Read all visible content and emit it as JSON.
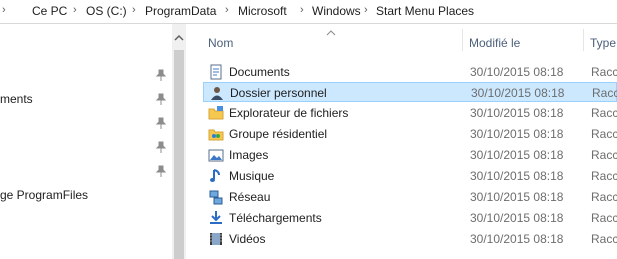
{
  "breadcrumb": {
    "parts": [
      "Ce PC",
      "OS (C:)",
      "ProgramData",
      "Microsoft",
      "Windows",
      "Start Menu Places"
    ]
  },
  "nav": {
    "items": [
      "ments",
      "ge ProgramFiles"
    ]
  },
  "columns": {
    "name": "Nom",
    "modified": "Modifié le",
    "type": "Type"
  },
  "files": [
    {
      "name": "Documents",
      "date": "30/10/2015 08:18",
      "type": "Racco",
      "icon": "documents-icon"
    },
    {
      "name": "Dossier personnel",
      "date": "30/10/2015 08:18",
      "type": "Racco",
      "icon": "user-folder-icon",
      "selected": true
    },
    {
      "name": "Explorateur de fichiers",
      "date": "30/10/2015 08:18",
      "type": "Racco",
      "icon": "folder-icon"
    },
    {
      "name": "Groupe résidentiel",
      "date": "30/10/2015 08:18",
      "type": "Racco",
      "icon": "homegroup-icon"
    },
    {
      "name": "Images",
      "date": "30/10/2015 08:18",
      "type": "Racco",
      "icon": "images-icon"
    },
    {
      "name": "Musique",
      "date": "30/10/2015 08:18",
      "type": "Racco",
      "icon": "music-icon"
    },
    {
      "name": "Réseau",
      "date": "30/10/2015 08:18",
      "type": "Racco",
      "icon": "network-icon"
    },
    {
      "name": "Téléchargements",
      "date": "30/10/2015 08:18",
      "type": "Racco",
      "icon": "downloads-icon"
    },
    {
      "name": "Vidéos",
      "date": "30/10/2015 08:18",
      "type": "Racco",
      "icon": "videos-icon"
    }
  ],
  "colors": {
    "selection_bg": "#cce8ff",
    "selection_border": "#99d1ff",
    "header_text": "#4c607a"
  }
}
